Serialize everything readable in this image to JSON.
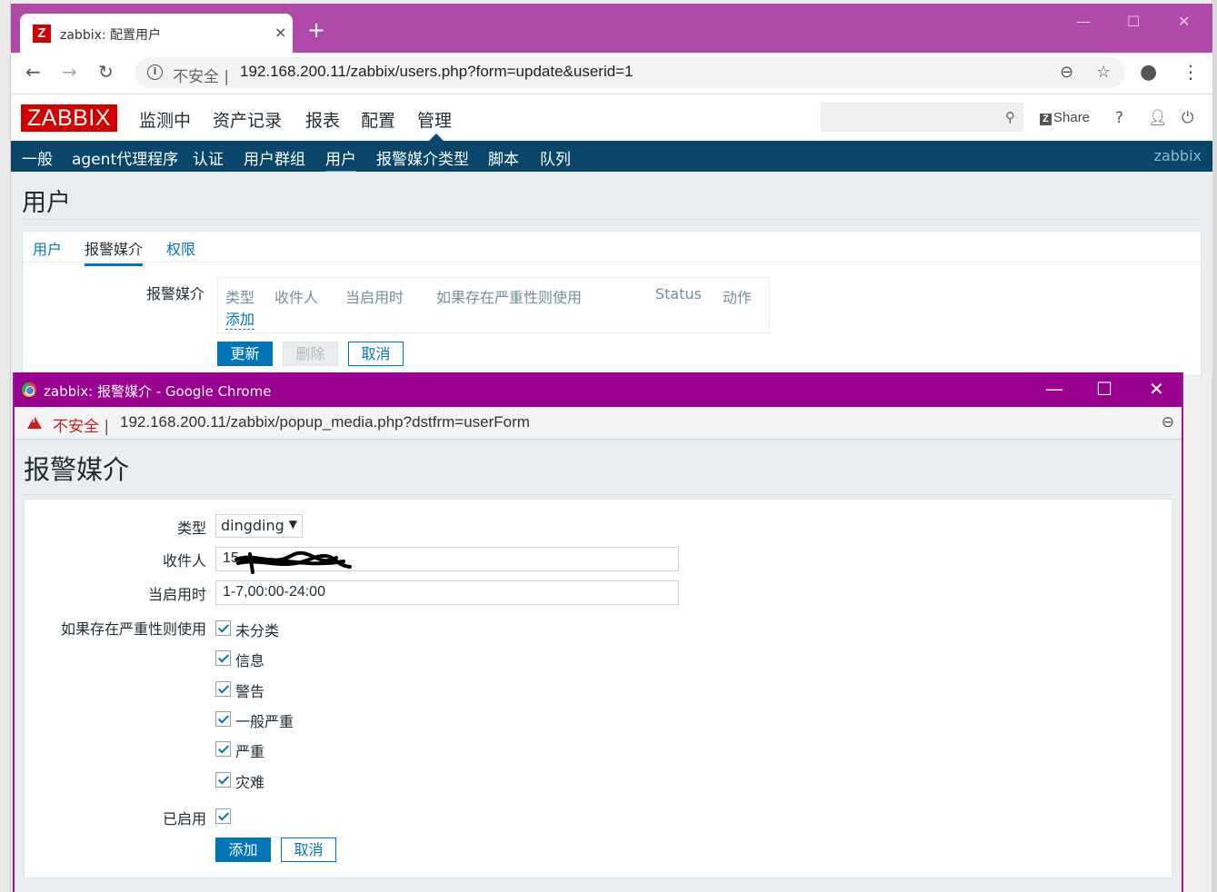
{
  "main_window": {
    "tab_title": "zabbix: 配置用户",
    "tab_close": "×",
    "new_tab": "+",
    "favicon_letter": "Z",
    "insecure_label": "不安全",
    "url": "192.168.200.11/zabbix/users.php?form=update&userid=1",
    "separator": "|"
  },
  "zabbix": {
    "logo": "ZABBIX",
    "top_menu": [
      "监测中",
      "资产记录",
      "报表",
      "配置",
      "管理"
    ],
    "share_label": "Share",
    "help_label": "?",
    "submenu": [
      "一般",
      "agent代理程序",
      "认证",
      "用户群组",
      "用户",
      "报警媒介类型",
      "脚本",
      "队列"
    ],
    "current_user": "zabbix",
    "page_title": "用户",
    "tabs": [
      "用户",
      "报警媒介",
      "权限"
    ],
    "media_label": "报警媒介",
    "media_table_headers": [
      "类型",
      "收件人",
      "当启用时",
      "如果存在严重性则使用",
      "Status",
      "动作"
    ],
    "add_link": "添加",
    "buttons": {
      "update": "更新",
      "delete": "删除",
      "cancel": "取消"
    }
  },
  "popup": {
    "window_title": "zabbix: 报警媒介 - Google Chrome",
    "insecure_label": "不安全",
    "separator": "|",
    "url": "192.168.200.11/zabbix/popup_media.php?dstfrm=userForm",
    "heading": "报警媒介",
    "form": {
      "type_label": "类型",
      "type_value": "dingding",
      "sendto_label": "收件人",
      "sendto_value": "15",
      "period_label": "当启用时",
      "period_value": "1-7,00:00-24:00",
      "severity_label": "如果存在严重性则使用",
      "severities": [
        {
          "label": "未分类",
          "checked": true
        },
        {
          "label": "信息",
          "checked": true
        },
        {
          "label": "警告",
          "checked": true
        },
        {
          "label": "一般严重",
          "checked": true
        },
        {
          "label": "严重",
          "checked": true
        },
        {
          "label": "灾难",
          "checked": true
        }
      ],
      "enabled_label": "已启用",
      "enabled": true
    },
    "buttons": {
      "add": "添加",
      "cancel": "取消"
    }
  },
  "colors": {
    "tab_strip": "#b04aa8",
    "popup_titlebar": "#9a0090",
    "zabbix_red": "#d40000",
    "zabbix_nav": "#0a466a",
    "zabbix_blue": "#0275b8"
  }
}
